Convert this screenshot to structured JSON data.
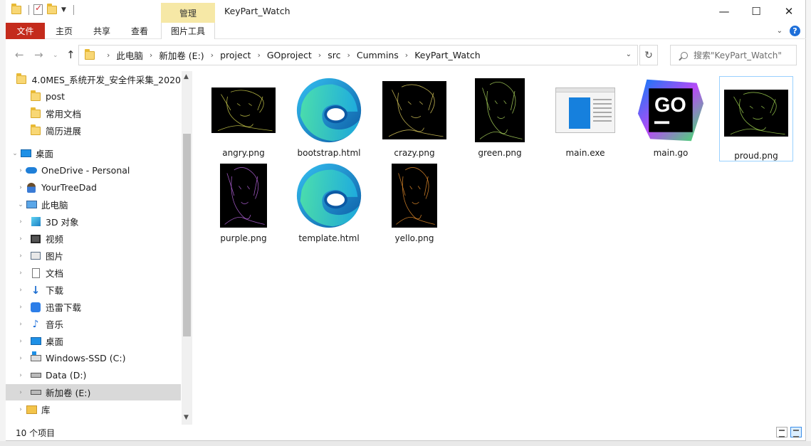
{
  "window": {
    "title": "KeyPart_Watch",
    "contextual_tab": "管理",
    "controls": {
      "minimize": "—",
      "maximize": "☐",
      "close": "✕"
    }
  },
  "ribbon": {
    "tabs": [
      "文件",
      "主页",
      "共享",
      "查看",
      "图片工具"
    ]
  },
  "address": {
    "path": [
      "此电脑",
      "新加卷 (E:)",
      "project",
      "GOproject",
      "src",
      "Cummins",
      "KeyPart_Watch"
    ],
    "search_placeholder": "搜索\"KeyPart_Watch\""
  },
  "nav_pane": {
    "items": [
      {
        "label": "4.0MES_系统开发_安全件采集_2020",
        "icon": "folder-icon",
        "level": 2,
        "caret": ""
      },
      {
        "label": "post",
        "icon": "folder-icon",
        "level": 2,
        "caret": ""
      },
      {
        "label": "常用文档",
        "icon": "folder-icon",
        "level": 2,
        "caret": ""
      },
      {
        "label": "简历进展",
        "icon": "folder-icon",
        "level": 2,
        "caret": ""
      },
      {
        "label": "桌面",
        "icon": "desktop-icon",
        "level": 0,
        "caret": "⌄"
      },
      {
        "label": "OneDrive - Personal",
        "icon": "onedrive-icon",
        "level": 1,
        "caret": "›"
      },
      {
        "label": "YourTreeDad",
        "icon": "user-icon",
        "level": 1,
        "caret": "›"
      },
      {
        "label": "此电脑",
        "icon": "this-pc-icon",
        "level": 1,
        "caret": "⌄"
      },
      {
        "label": "3D 对象",
        "icon": "3d-objects-icon",
        "level": 2,
        "caret": "›"
      },
      {
        "label": "视频",
        "icon": "video-icon",
        "level": 2,
        "caret": "›"
      },
      {
        "label": "图片",
        "icon": "pictures-icon",
        "level": 2,
        "caret": "›"
      },
      {
        "label": "文档",
        "icon": "documents-icon",
        "level": 2,
        "caret": "›"
      },
      {
        "label": "下载",
        "icon": "downloads-icon",
        "level": 2,
        "caret": "›"
      },
      {
        "label": "迅雷下载",
        "icon": "xunlei-icon",
        "level": 2,
        "caret": "›"
      },
      {
        "label": "音乐",
        "icon": "music-icon",
        "level": 2,
        "caret": "›"
      },
      {
        "label": "桌面",
        "icon": "desktop-icon",
        "level": 2,
        "caret": "›"
      },
      {
        "label": "Windows-SSD (C:)",
        "icon": "windows-drive-icon",
        "level": 2,
        "caret": "›"
      },
      {
        "label": "Data (D:)",
        "icon": "drive-icon",
        "level": 2,
        "caret": "›"
      },
      {
        "label": "新加卷 (E:)",
        "icon": "drive-icon",
        "level": 2,
        "caret": "›",
        "selected": true
      },
      {
        "label": "库",
        "icon": "library-icon",
        "level": 1,
        "caret": "›"
      }
    ]
  },
  "files": [
    {
      "name": "angry.png",
      "type": "image",
      "tint": "#c9c94a"
    },
    {
      "name": "bootstrap.html",
      "type": "edge"
    },
    {
      "name": "crazy.png",
      "type": "image",
      "tint": "#d8c85a"
    },
    {
      "name": "green.png",
      "type": "image",
      "tint": "#a8d15a"
    },
    {
      "name": "main.exe",
      "type": "exe"
    },
    {
      "name": "main.go",
      "type": "go",
      "badge": "GO"
    },
    {
      "name": "proud.png",
      "type": "image",
      "tint": "#9ccf4f",
      "selected": true
    },
    {
      "name": "purple.png",
      "type": "image",
      "tint": "#b262d8"
    },
    {
      "name": "template.html",
      "type": "edge"
    },
    {
      "name": "yello.png",
      "type": "image",
      "tint": "#e08a2a"
    }
  ],
  "status": {
    "item_count": "10 个项目"
  },
  "colors": {
    "file_tab": "#c42b1c",
    "manage_tab": "#f6e8a6",
    "selection": "#d9d9d9",
    "accent": "#1e6fd9"
  }
}
